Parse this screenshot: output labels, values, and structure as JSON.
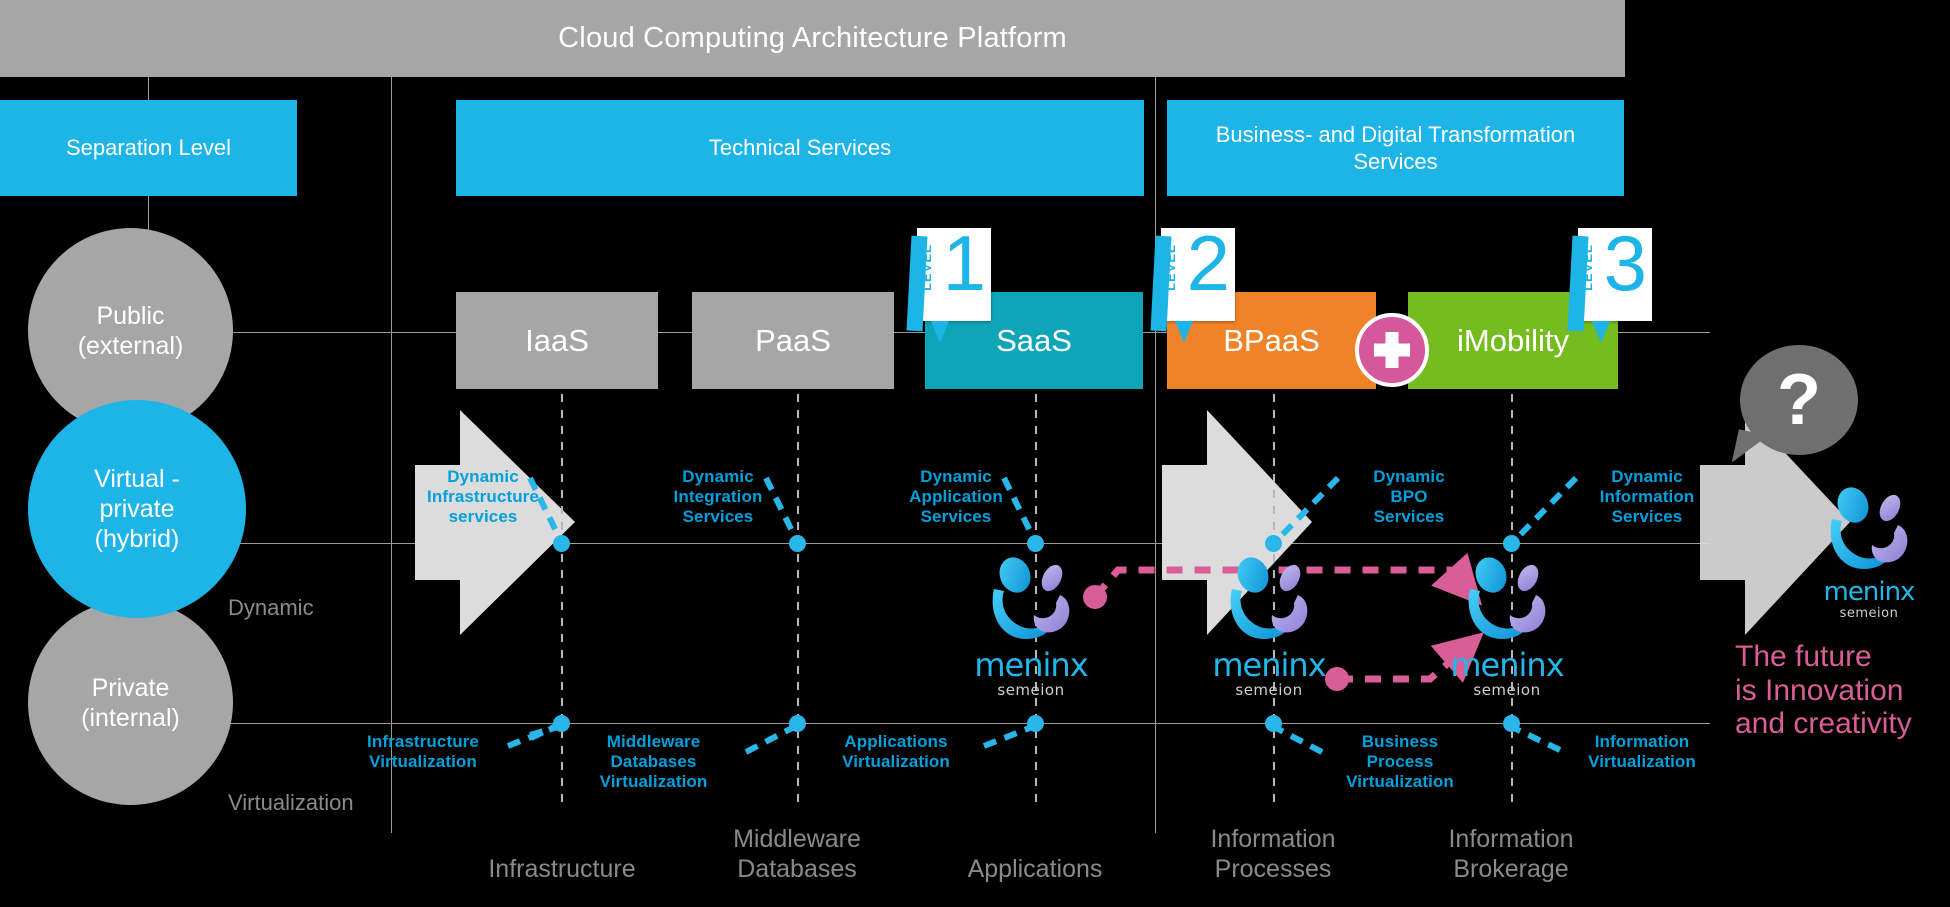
{
  "header": {
    "title": "Cloud Computing Architecture Platform"
  },
  "bands": [
    {
      "id": "separation",
      "label": "Separation Level"
    },
    {
      "id": "technical",
      "label": "Technical Services"
    },
    {
      "id": "business",
      "label": "Business- and Digital Transformation Services"
    }
  ],
  "separation_levels": [
    {
      "id": "public",
      "label": "Public\n(external)",
      "color": "#a6a6a6"
    },
    {
      "id": "virtual",
      "label": "Virtual -\nprivate\n(hybrid)",
      "color": "#1db4e7"
    },
    {
      "id": "private",
      "label": "Private\n(internal)",
      "color": "#a6a6a6"
    }
  ],
  "axis_labels": {
    "dynamic": "Dynamic",
    "virtualization": "Virtualization"
  },
  "service_boxes": [
    {
      "id": "iaas",
      "label": "IaaS",
      "color": "#a6a6a6"
    },
    {
      "id": "paas",
      "label": "PaaS",
      "color": "#a6a6a6"
    },
    {
      "id": "saas",
      "label": "SaaS",
      "color": "#0fa5b9"
    },
    {
      "id": "bpaas",
      "label": "BPaaS",
      "color": "#f08228"
    },
    {
      "id": "imobility",
      "label": "iMobility",
      "color": "#76bc21"
    }
  ],
  "level_badges": [
    {
      "caption": "LEVEL",
      "number": "1"
    },
    {
      "caption": "LEVEL",
      "number": "2"
    },
    {
      "caption": "LEVEL",
      "number": "3"
    }
  ],
  "dynamic_labels": [
    {
      "id": "dyn-infra",
      "lines": [
        "Dynamic",
        "Infrastructure",
        "services"
      ]
    },
    {
      "id": "dyn-integ",
      "lines": [
        "Dynamic",
        "Integration",
        "Services"
      ]
    },
    {
      "id": "dyn-app",
      "lines": [
        "Dynamic",
        "Application",
        "Services"
      ]
    },
    {
      "id": "dyn-bpo",
      "lines": [
        "Dynamic",
        "BPO",
        "Services"
      ]
    },
    {
      "id": "dyn-info",
      "lines": [
        "Dynamic",
        "Information",
        "Services"
      ]
    }
  ],
  "virtualization_labels": [
    {
      "id": "virt-infra",
      "lines": [
        "Infrastructure",
        "Virtualization"
      ]
    },
    {
      "id": "virt-middle",
      "lines": [
        "Middleware",
        "Databases",
        "Virtualization"
      ]
    },
    {
      "id": "virt-app",
      "lines": [
        "Applications",
        "Virtualization"
      ]
    },
    {
      "id": "virt-bp",
      "lines": [
        "Business",
        "Process",
        "Virtualization"
      ]
    },
    {
      "id": "virt-info",
      "lines": [
        "Information",
        "Virtualization"
      ]
    }
  ],
  "column_labels": [
    {
      "id": "col-infra",
      "lines": [
        "Infrastructure"
      ]
    },
    {
      "id": "col-middle",
      "lines": [
        "Middleware",
        "Databases"
      ]
    },
    {
      "id": "col-app",
      "lines": [
        "Applications"
      ]
    },
    {
      "id": "col-procs",
      "lines": [
        "Information",
        "Processes"
      ]
    },
    {
      "id": "col-broker",
      "lines": [
        "Information",
        "Brokerage"
      ]
    }
  ],
  "logo": {
    "word": "meninx",
    "subtitle": "semeion"
  },
  "question_badge": {
    "glyph": "?"
  },
  "tagline": {
    "lines": [
      "The future",
      "is Innovation",
      "and creativity"
    ],
    "color": "#d95d96"
  },
  "colors": {
    "background": "#000000",
    "brand_blue": "#1db4e7",
    "label_blue": "#00a0dc",
    "gray": "#a6a6a6",
    "teal": "#0fa5b9",
    "orange": "#f08228",
    "green": "#76bc21",
    "pink": "#d95d96",
    "title_bar": "#a6a6a6"
  }
}
